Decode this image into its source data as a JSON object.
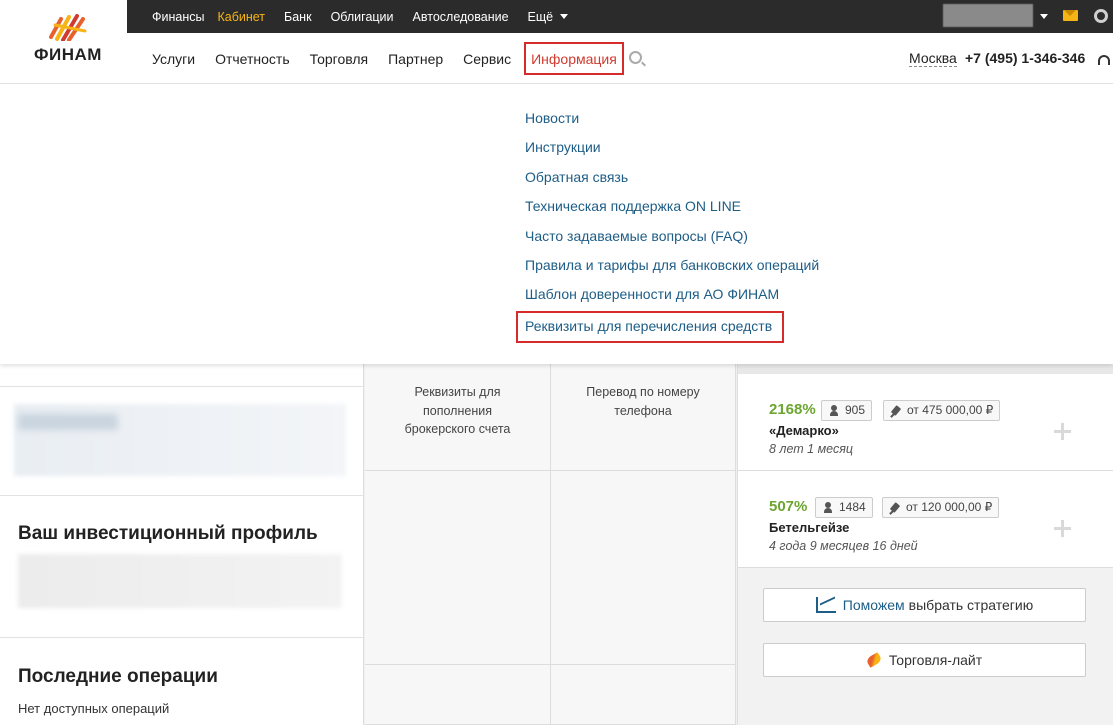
{
  "topbar": {
    "items": [
      "Финансы",
      "Кабинет",
      "Банк",
      "Облигации",
      "Автоследование"
    ],
    "more_label": "Ещё"
  },
  "header": {
    "logo_text": "ФИНАМ",
    "nav": [
      "Услуги",
      "Отчетность",
      "Торговля",
      "Партнер",
      "Сервис"
    ],
    "active_nav": "Информация",
    "city": "Москва",
    "phone": "+7 (495) 1-346-346"
  },
  "dropdown": {
    "items": [
      "Новости",
      "Инструкции",
      "Обратная связь",
      "Техническая поддержка ON LINE",
      "Часто задаваемые вопросы (FAQ)",
      "Правила и тарифы для банковских операций",
      "Шаблон доверенности для АО ФИНАМ"
    ],
    "highlighted_item": "Реквизиты для перечисления средств"
  },
  "left": {
    "profile_title": "Ваш инвестиционный профиль",
    "ops_title": "Последние операции",
    "no_ops": "Нет доступных операций"
  },
  "middle": {
    "cell1": "Реквизиты для пополнения брокерского счета",
    "cell2": "Перевод по номеру телефона"
  },
  "strategies": [
    {
      "pct": "2168%",
      "subscribers": "905",
      "min": "от 475 000,00 ₽",
      "name": "«Демарко»",
      "duration": "8 лет 1 месяц"
    },
    {
      "pct": "507%",
      "subscribers": "1484",
      "min": "от 120 000,00 ₽",
      "name": "Бетельгейзе",
      "duration": "4 года 9 месяцев 16 дней"
    }
  ],
  "buttons": {
    "choose_blue": "Поможем",
    "choose_rest": "выбрать стратегию",
    "lite": "Торговля-лайт"
  },
  "colors": {
    "accent_yellow": "#f7b515",
    "highlight_red": "#d62b2b",
    "link_blue": "#1e5d86",
    "pct_green": "#6ca52f"
  }
}
